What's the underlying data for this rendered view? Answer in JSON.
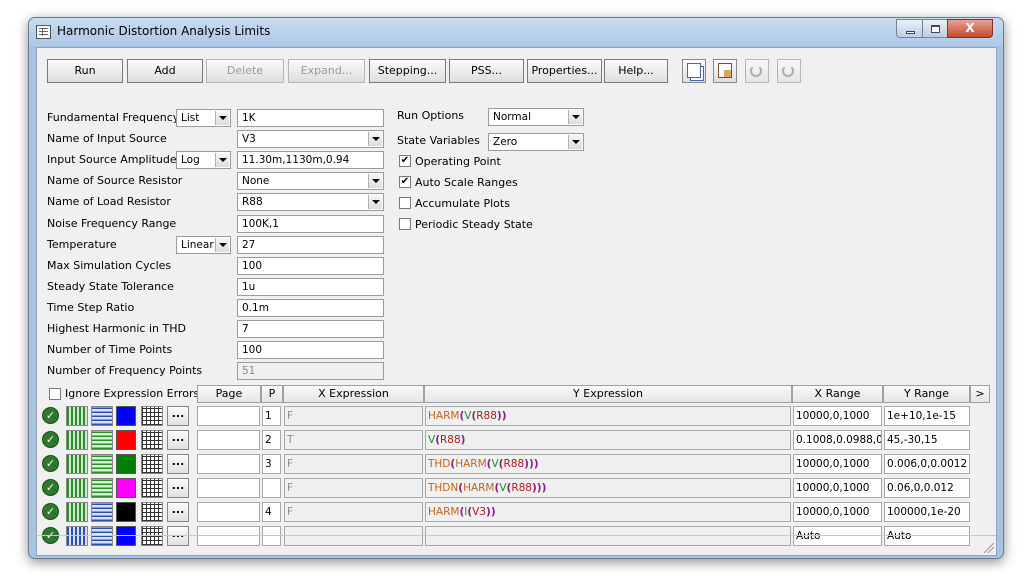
{
  "window": {
    "title": "Harmonic Distortion Analysis Limits",
    "close_glyph": "X"
  },
  "toolbar": {
    "buttons": [
      {
        "label": "Run",
        "enabled": true
      },
      {
        "label": "Add",
        "enabled": true
      },
      {
        "label": "Delete",
        "enabled": false
      },
      {
        "label": "Expand...",
        "enabled": false
      },
      {
        "label": "Stepping...",
        "enabled": true
      },
      {
        "label": "PSS...",
        "enabled": true
      },
      {
        "label": "Properties...",
        "enabled": true
      },
      {
        "label": "Help...",
        "enabled": true
      }
    ],
    "icons": [
      "copy-icon",
      "paste-icon",
      "undo-icon",
      "redo-icon"
    ]
  },
  "fields": [
    {
      "label": "Fundamental Frequency",
      "mode": "List",
      "value": "1K"
    },
    {
      "label": "Name of Input Source",
      "value": "V3",
      "dropdown": true
    },
    {
      "label": "Input Source Amplitude",
      "mode": "Log",
      "value": "11.30m,1130m,0.94"
    },
    {
      "label": "Name of Source Resistor",
      "value": "None",
      "dropdown": true
    },
    {
      "label": "Name of Load Resistor",
      "value": "R88",
      "dropdown": true
    },
    {
      "label": "Noise Frequency Range",
      "value": "100K,1"
    },
    {
      "label": "Temperature",
      "mode": "Linear",
      "value": "27"
    },
    {
      "label": "Max Simulation Cycles",
      "value": "100"
    },
    {
      "label": "Steady State Tolerance",
      "value": "1u"
    },
    {
      "label": "Time Step Ratio",
      "value": "0.1m"
    },
    {
      "label": "Highest Harmonic in THD",
      "value": "7"
    },
    {
      "label": "Number of Time Points",
      "value": "100"
    },
    {
      "label": "Number of Frequency Points",
      "value": "51",
      "disabled": true
    }
  ],
  "run_options": {
    "label": "Run Options",
    "value": "Normal"
  },
  "state_variables": {
    "label": "State Variables",
    "value": "Zero"
  },
  "checkboxes": [
    {
      "label": "Operating Point",
      "checked": true
    },
    {
      "label": "Auto Scale Ranges",
      "checked": true
    },
    {
      "label": "Accumulate Plots",
      "checked": false
    },
    {
      "label": "Periodic Steady State",
      "checked": false
    }
  ],
  "check_glyph": "✔",
  "grid": {
    "ignore_errors": {
      "label": "Ignore Expression Errors",
      "checked": false
    },
    "headers": {
      "page": "Page",
      "p": "P",
      "x": "X Expression",
      "y": "Y Expression",
      "xr": "X Range",
      "yr": "Y Range",
      "more": ">"
    },
    "row_button": "...",
    "ok_glyph": "✓",
    "rows": [
      {
        "color": "#0000ff",
        "page": "",
        "p": "1",
        "x": "F",
        "y_parts": [
          [
            "HARM",
            "cf"
          ],
          [
            "(",
            "cp"
          ],
          [
            "V",
            "cv"
          ],
          [
            "(",
            "cp"
          ],
          [
            "R88",
            "cr"
          ],
          [
            "))",
            "cp"
          ]
        ],
        "xr": "10000,0,1000",
        "yr": "1e+10,1e-15"
      },
      {
        "color": "#ff0000",
        "page": "",
        "p": "2",
        "x": "T",
        "y_parts": [
          [
            "V",
            "cv"
          ],
          [
            "(",
            "cp"
          ],
          [
            "R88",
            "cr"
          ],
          [
            ")",
            "cp"
          ]
        ],
        "xr": "0.1008,0.0988,0",
        "yr": "45,-30,15"
      },
      {
        "color": "#008000",
        "page": "",
        "p": "3",
        "x": "F",
        "y_parts": [
          [
            "THD",
            "cf"
          ],
          [
            "(",
            "cp"
          ],
          [
            "HARM",
            "cf"
          ],
          [
            "(",
            "cp"
          ],
          [
            "V",
            "cv"
          ],
          [
            "(",
            "cp"
          ],
          [
            "R88",
            "cr"
          ],
          [
            ")))",
            "cp"
          ]
        ],
        "xr": "10000,0,1000",
        "yr": "0.006,0,0.0012"
      },
      {
        "color": "#ff00ff",
        "page": "",
        "p": "",
        "x": "F",
        "y_parts": [
          [
            "THDN",
            "cf"
          ],
          [
            "(",
            "cp"
          ],
          [
            "HARM",
            "cf"
          ],
          [
            "(",
            "cp"
          ],
          [
            "V",
            "cv"
          ],
          [
            "(",
            "cp"
          ],
          [
            "R88",
            "cr"
          ],
          [
            ")))",
            "cp"
          ]
        ],
        "xr": "10000,0,1000",
        "yr": "0.06,0,0.012"
      },
      {
        "color": "#000000",
        "page": "",
        "p": "4",
        "x": "F",
        "y_parts": [
          [
            "HARM",
            "cf"
          ],
          [
            "(",
            "cp"
          ],
          [
            "I",
            "cv"
          ],
          [
            "(",
            "cp"
          ],
          [
            "V3",
            "cr"
          ],
          [
            "))",
            "cp"
          ]
        ],
        "xr": "10000,0,1000",
        "yr": "100000,1e-20"
      },
      {
        "color": "#0000ff",
        "page": "",
        "p": "",
        "x": "",
        "y_parts": [],
        "xr": "Auto",
        "yr": "Auto"
      }
    ]
  }
}
